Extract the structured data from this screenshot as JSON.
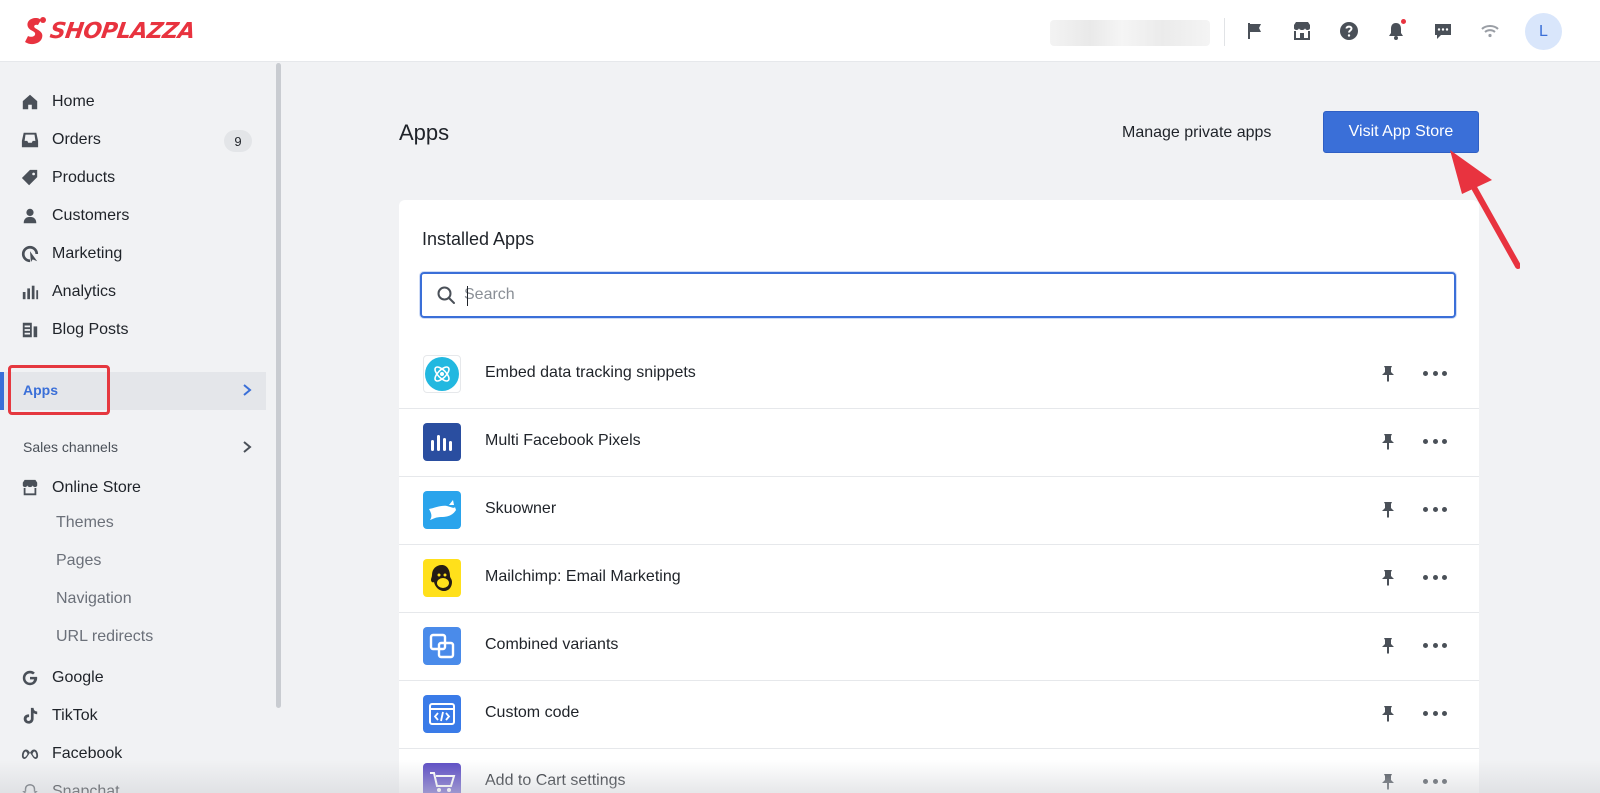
{
  "brand": {
    "name": "SHOPLAZZA",
    "color": "#e8333f"
  },
  "topbar": {
    "icons": [
      "flag-icon",
      "store-icon",
      "help-icon",
      "bell-icon",
      "chat-icon",
      "wifi-icon"
    ],
    "avatar_initial": "L"
  },
  "sidebar": {
    "items": [
      {
        "label": "Home",
        "icon": "home-icon"
      },
      {
        "label": "Orders",
        "icon": "inbox-icon",
        "badge": "9"
      },
      {
        "label": "Products",
        "icon": "tag-icon"
      },
      {
        "label": "Customers",
        "icon": "person-icon"
      },
      {
        "label": "Marketing",
        "icon": "target-icon"
      },
      {
        "label": "Analytics",
        "icon": "bar-chart-icon"
      },
      {
        "label": "Blog Posts",
        "icon": "document-icon"
      }
    ],
    "apps_label": "Apps",
    "sales_channels_label": "Sales channels",
    "online_store": {
      "label": "Online Store",
      "sub_items": [
        "Themes",
        "Pages",
        "Navigation",
        "URL redirects"
      ]
    },
    "channels": [
      {
        "label": "Google",
        "icon": "google-icon"
      },
      {
        "label": "TikTok",
        "icon": "tiktok-icon"
      },
      {
        "label": "Facebook",
        "icon": "meta-icon"
      },
      {
        "label": "Snapchat",
        "icon": "snapchat-icon"
      }
    ],
    "accent": "#3a6fd8"
  },
  "main": {
    "title": "Apps",
    "manage_private_apps": "Manage private apps",
    "visit_app_store": "Visit App Store",
    "installed_title": "Installed Apps",
    "search_placeholder": "Search",
    "apps": [
      {
        "name": "Embed data tracking snippets",
        "icon": "tracking-icon"
      },
      {
        "name": "Multi Facebook Pixels",
        "icon": "pixels-icon"
      },
      {
        "name": "Skuowner",
        "icon": "whale-icon"
      },
      {
        "name": "Mailchimp: Email Marketing",
        "icon": "mailchimp-icon"
      },
      {
        "name": "Combined variants",
        "icon": "variants-icon"
      },
      {
        "name": "Custom code",
        "icon": "code-icon"
      },
      {
        "name": "Add to Cart settings",
        "icon": "cart-icon"
      }
    ]
  }
}
